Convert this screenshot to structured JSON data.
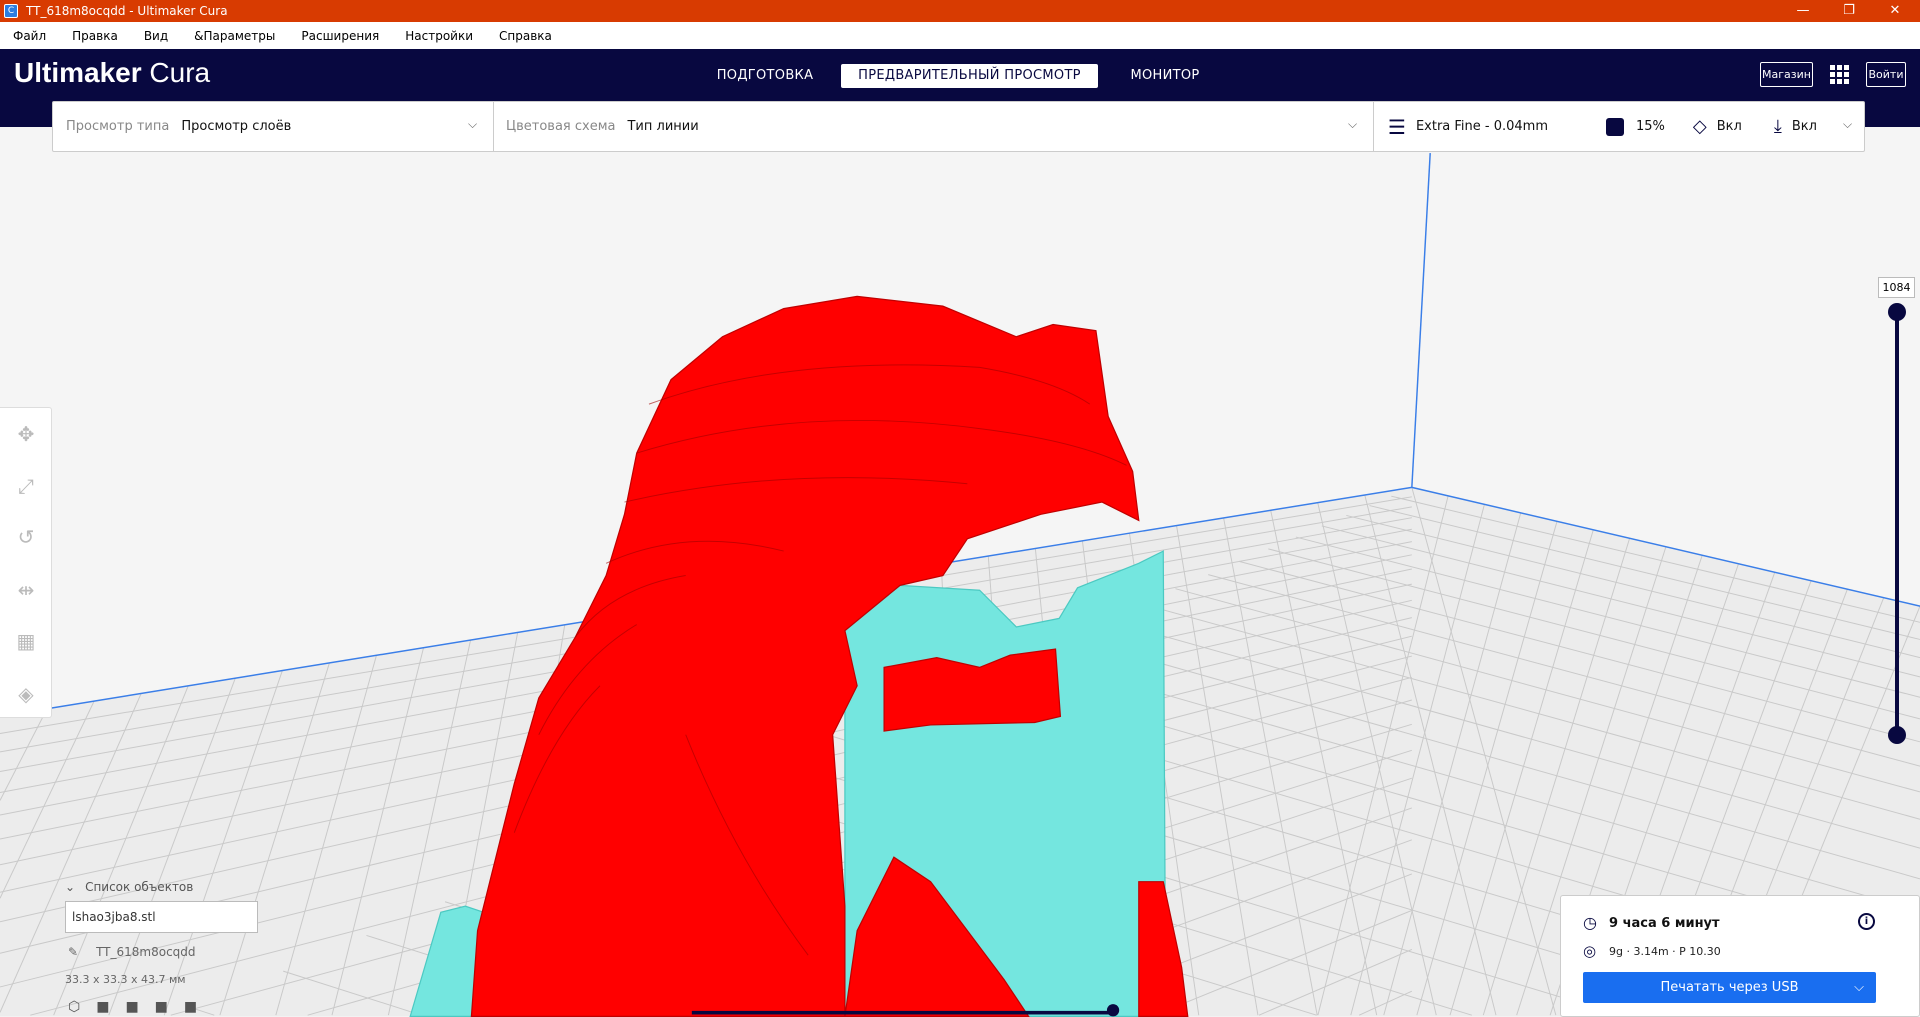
{
  "window": {
    "title": "TT_618m8ocqdd - Ultimaker Cura",
    "app_icon": "C",
    "minimize": "—",
    "restore": "❐",
    "close": "✕"
  },
  "menu": [
    "Файл",
    "Правка",
    "Вид",
    "&Параметры",
    "Расширения",
    "Настройки",
    "Справка"
  ],
  "header": {
    "logo_bold": "Ultimaker",
    "logo_light": "Cura",
    "tabs": [
      "ПОДГОТОВКА",
      "ПРЕДВАРИТЕЛЬНЫЙ ПРОСМОТР",
      "МОНИТОР"
    ],
    "active_tab": 1,
    "marketplace": "Магазин",
    "signin": "Войти"
  },
  "toolbar": {
    "view_type_label": "Просмотр типа",
    "view_type_value": "Просмотр слоёв",
    "color_scheme_label": "Цветовая схема",
    "color_scheme_value": "Тип линии",
    "profile": "Extra Fine - 0.04mm",
    "infill": "15%",
    "support": "Вкл",
    "adhesion": "Вкл"
  },
  "layer_slider": {
    "current_layer": "1084"
  },
  "object_list": {
    "title": "Список объектов",
    "file": "lshao3jba8.stl",
    "job_name": "TT_618m8ocqdd",
    "dimensions": "33.3 x 33.3 x 43.7 мм"
  },
  "print_panel": {
    "time": "9 часа 6 минут",
    "material": "9g · 3.14m · Р 10.30",
    "print_button": "Печатать через USB"
  },
  "colors": {
    "titlebar": "#d83b01",
    "header": "#080840",
    "accent": "#196ef0",
    "model": "#ff0000",
    "support": "#74e6df"
  }
}
